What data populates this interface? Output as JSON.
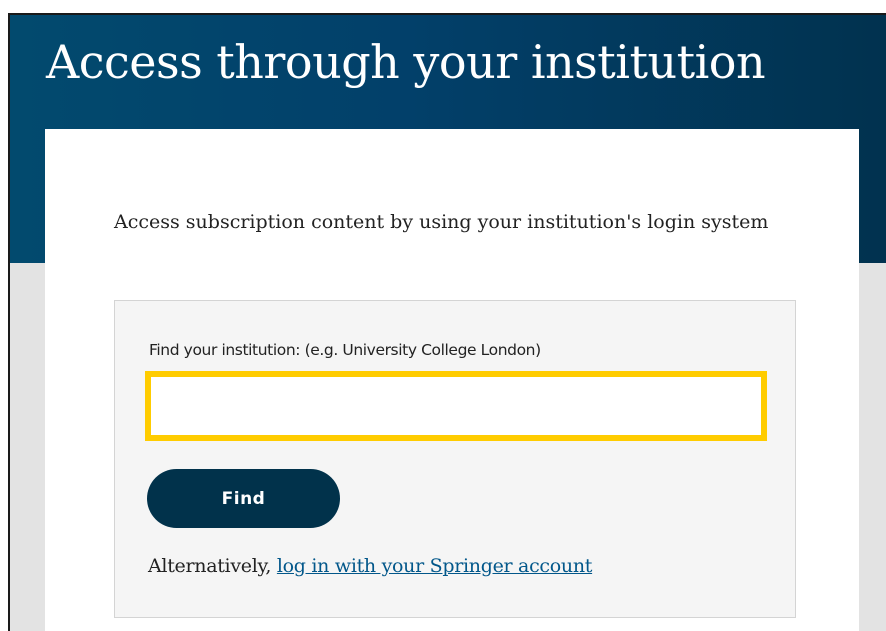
{
  "header": {
    "title": "Access through your institution"
  },
  "card": {
    "intro": "Access subscription content by using your institution's login system"
  },
  "finder": {
    "label": "Find your institution: (e.g. University College London)",
    "input_value": "",
    "input_placeholder": "",
    "find_button_label": "Find",
    "alternative_prefix": "Alternatively, ",
    "alternative_link_label": "log in with your Springer account"
  },
  "colors": {
    "header_bg": "#024a6e",
    "button_bg": "#01324b",
    "input_focus_border": "#ffcc00",
    "link": "#02578a"
  }
}
